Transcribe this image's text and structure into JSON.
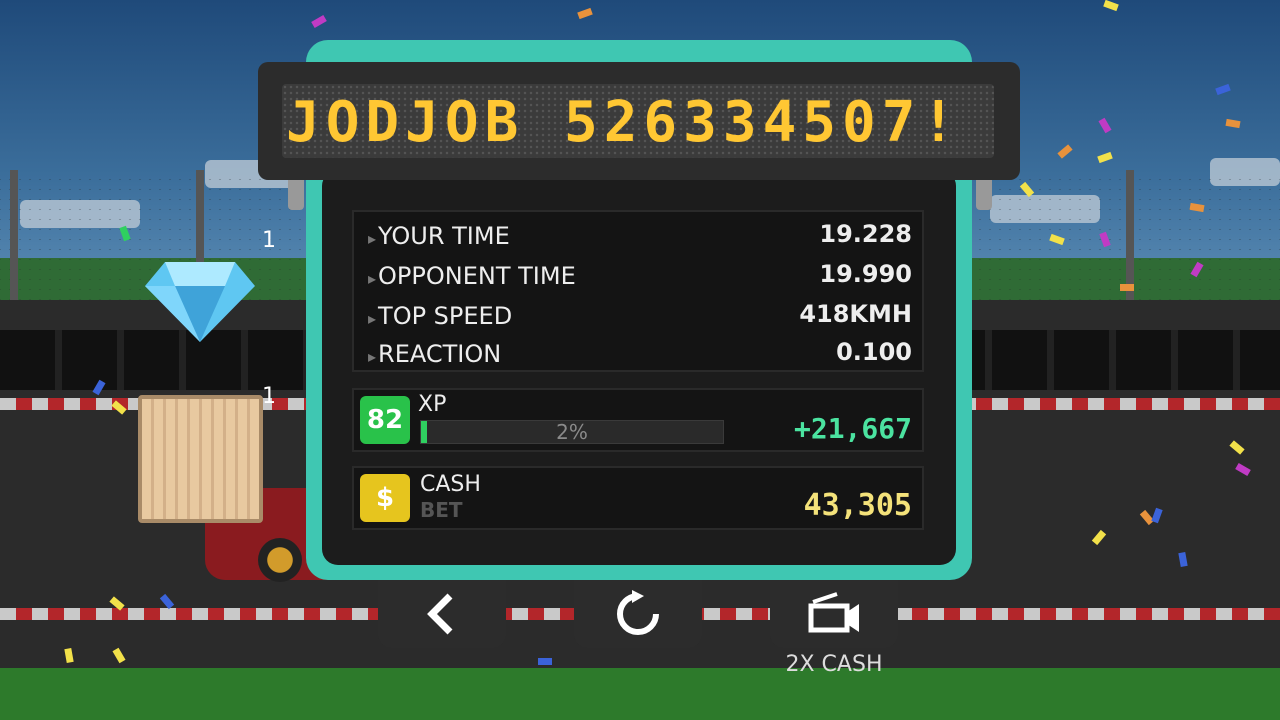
{
  "sign": {
    "text": "JODJOB 526334507!"
  },
  "rewards": [
    {
      "icon": "diamond-icon",
      "count": "1"
    },
    {
      "icon": "crate-icon",
      "count": "1"
    }
  ],
  "results": {
    "rows": [
      {
        "label": "YOUR TIME",
        "value": "19.228"
      },
      {
        "label": "OPPONENT TIME",
        "value": "19.990"
      },
      {
        "label": "TOP SPEED",
        "value": "418KMH"
      },
      {
        "label": "REACTION",
        "value": "0.100"
      }
    ]
  },
  "xp": {
    "level": "82",
    "label": "XP",
    "progress_percent": 2,
    "progress_text": "2%",
    "gain": "+21,667"
  },
  "cash": {
    "icon": "dollar-icon",
    "label": "CASH",
    "sub_label": "BET",
    "value": "43,305"
  },
  "buttons": {
    "back": {
      "icon": "back-arrow-icon"
    },
    "restart": {
      "icon": "restart-icon"
    },
    "video": {
      "icon": "video-ad-icon",
      "label": "2X CASH"
    }
  },
  "colors": {
    "panel": "#3fc7b2",
    "sign_text": "#ffc733",
    "xp_gain": "#4be3a0",
    "cash_value": "#f4e27a"
  }
}
